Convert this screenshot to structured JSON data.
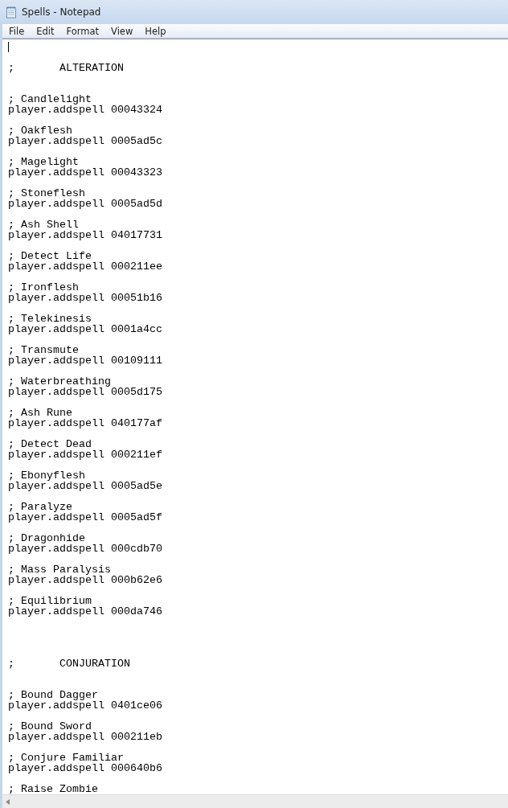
{
  "window": {
    "title": "Spells - Notepad"
  },
  "menu": [
    "File",
    "Edit",
    "Format",
    "View",
    "Help"
  ],
  "editor": {
    "sections": [
      {
        "heading": ";       ALTERATION",
        "entries": [
          {
            "comment": "; Candlelight",
            "command": "player.addspell 00043324"
          },
          {
            "comment": "; Oakflesh",
            "command": "player.addspell 0005ad5c"
          },
          {
            "comment": "; Magelight",
            "command": "player.addspell 00043323"
          },
          {
            "comment": "; Stoneflesh",
            "command": "player.addspell 0005ad5d"
          },
          {
            "comment": "; Ash Shell",
            "command": "player.addspell 04017731"
          },
          {
            "comment": "; Detect Life",
            "command": "player.addspell 000211ee"
          },
          {
            "comment": "; Ironflesh",
            "command": "player.addspell 00051b16"
          },
          {
            "comment": "; Telekinesis",
            "command": "player.addspell 0001a4cc"
          },
          {
            "comment": "; Transmute",
            "command": "player.addspell 00109111"
          },
          {
            "comment": "; Waterbreathing",
            "command": "player.addspell 0005d175"
          },
          {
            "comment": "; Ash Rune",
            "command": "player.addspell 040177af"
          },
          {
            "comment": "; Detect Dead",
            "command": "player.addspell 000211ef"
          },
          {
            "comment": "; Ebonyflesh",
            "command": "player.addspell 0005ad5e"
          },
          {
            "comment": "; Paralyze",
            "command": "player.addspell 0005ad5f"
          },
          {
            "comment": "; Dragonhide",
            "command": "player.addspell 000cdb70"
          },
          {
            "comment": "; Mass Paralysis",
            "command": "player.addspell 000b62e6"
          },
          {
            "comment": "; Equilibrium",
            "command": "player.addspell 000da746"
          }
        ]
      },
      {
        "heading": ";       CONJURATION",
        "entries": [
          {
            "comment": "; Bound Dagger",
            "command": "player.addspell 0401ce06"
          },
          {
            "comment": "; Bound Sword",
            "command": "player.addspell 000211eb"
          },
          {
            "comment": "; Conjure Familiar",
            "command": "player.addspell 000640b6"
          },
          {
            "comment": "; Raise Zombie"
          }
        ]
      }
    ]
  }
}
